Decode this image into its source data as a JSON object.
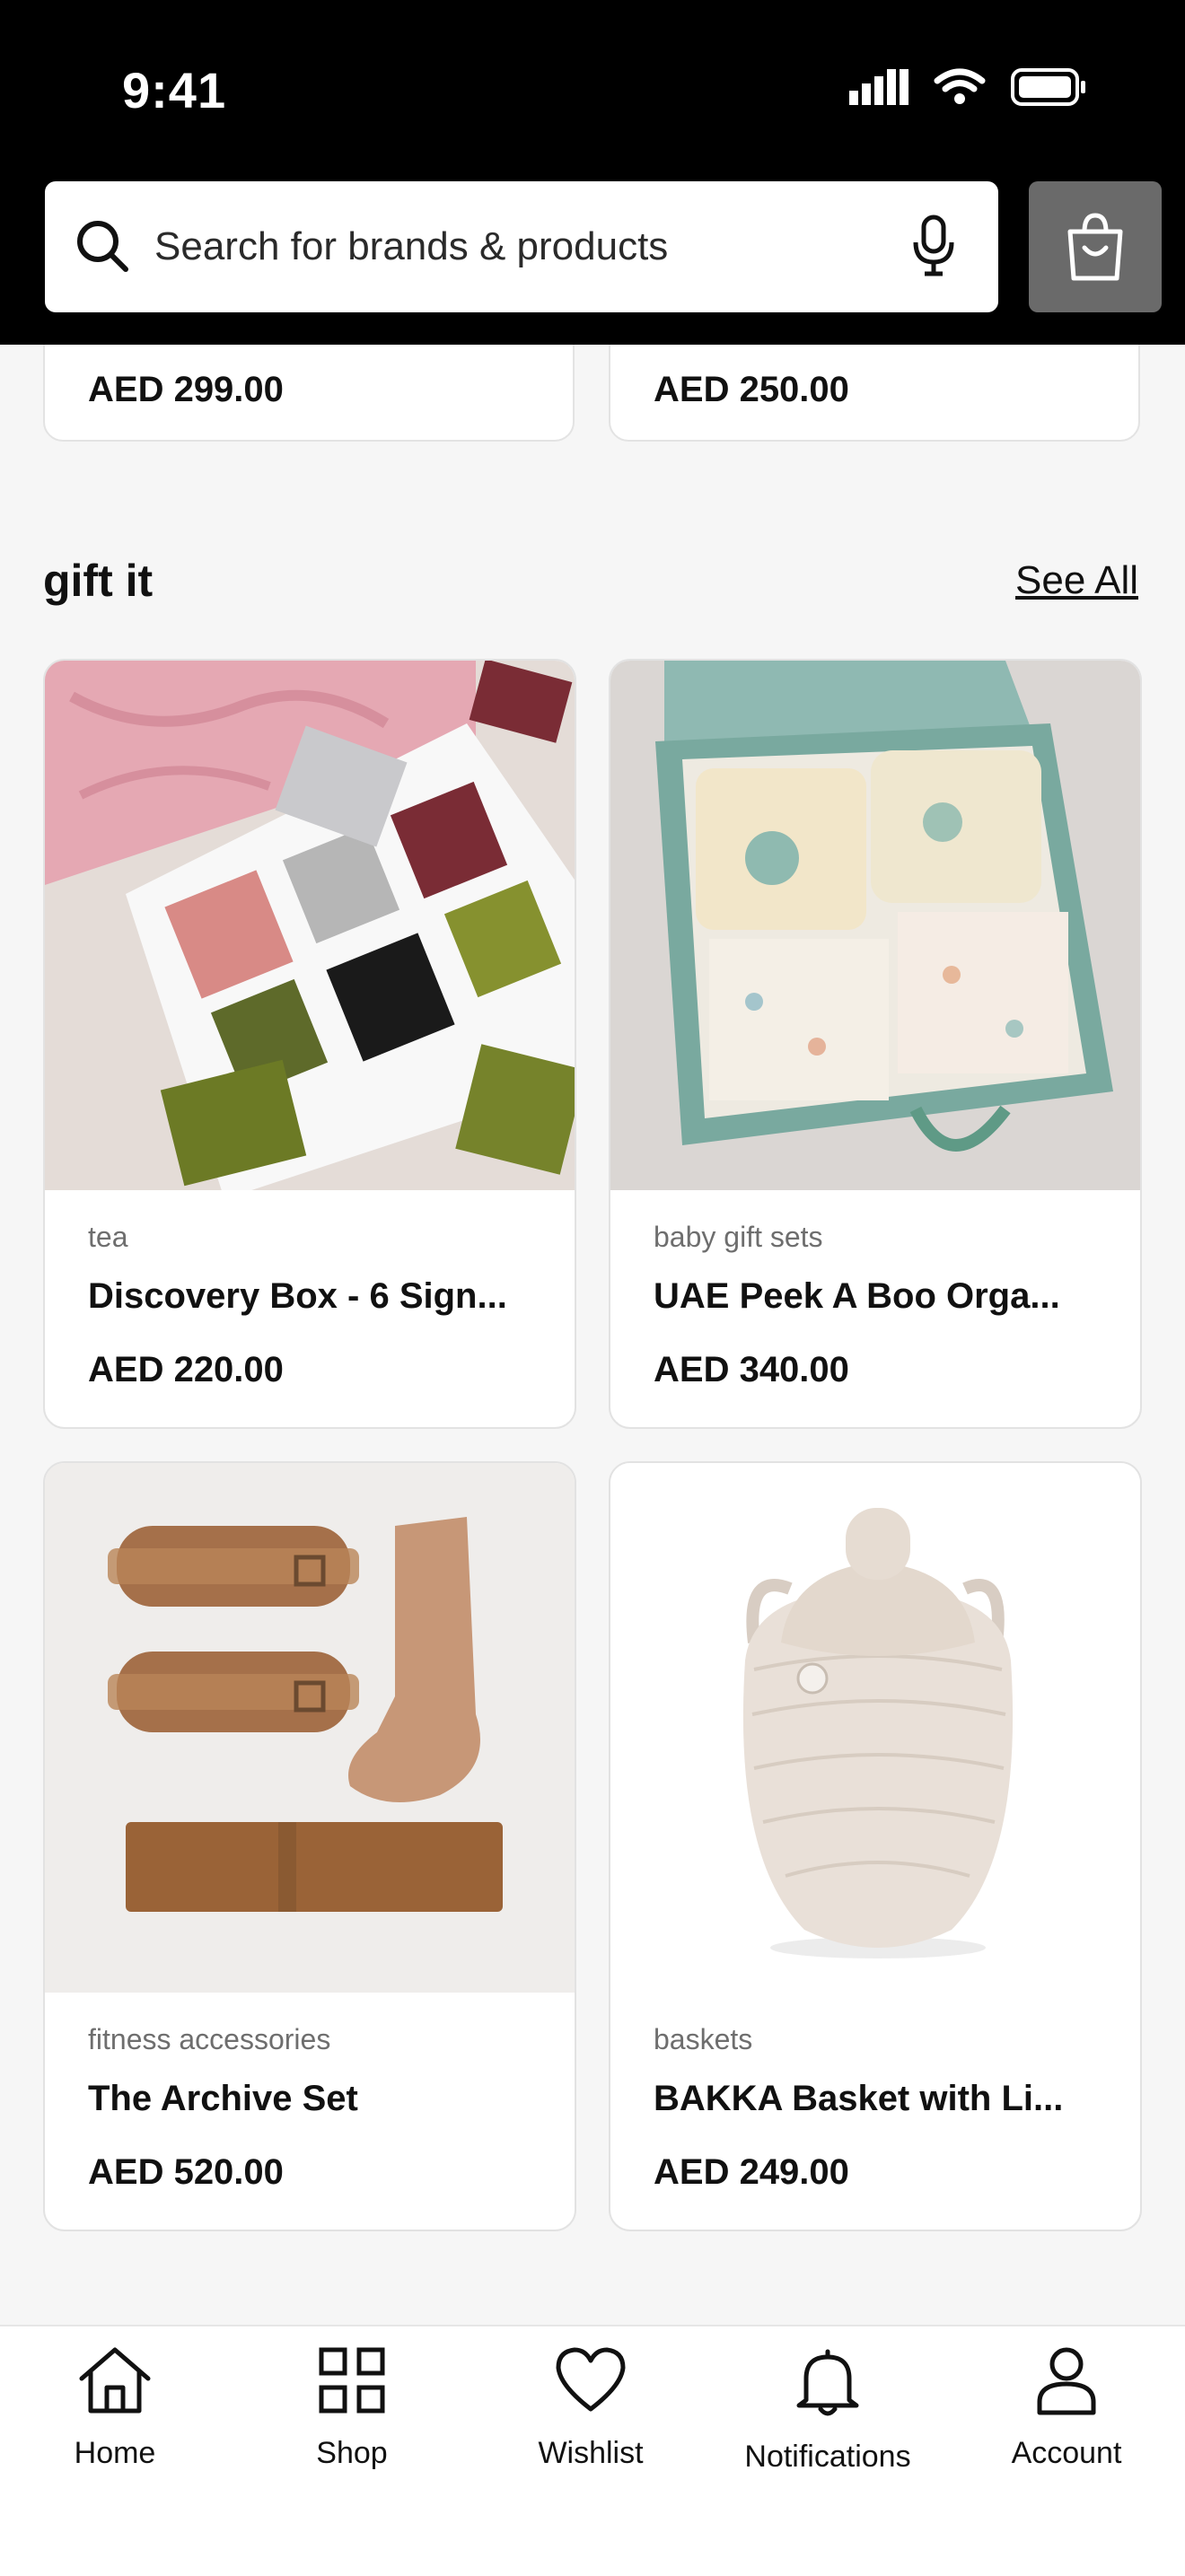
{
  "status_bar": {
    "time": "9:41"
  },
  "search": {
    "placeholder": "Search for brands & products"
  },
  "partial_cards": [
    {
      "price": "AED 299.00"
    },
    {
      "price": "AED 250.00"
    }
  ],
  "section": {
    "title": "gift it",
    "see_all": "See All"
  },
  "products": [
    {
      "category": "tea",
      "name": "Discovery Box - 6 Sign...",
      "price": "AED 220.00"
    },
    {
      "category": "baby gift sets",
      "name": "UAE Peek A Boo Orga...",
      "price": "AED 340.00"
    },
    {
      "category": "fitness accessories",
      "name": "The Archive Set",
      "price": "AED 520.00"
    },
    {
      "category": "baskets",
      "name": "BAKKA Basket with Li...",
      "price": "AED 249.00"
    }
  ],
  "nav": {
    "items": [
      {
        "label": "Home",
        "icon": "home-icon"
      },
      {
        "label": "Shop",
        "icon": "grid-icon"
      },
      {
        "label": "Wishlist",
        "icon": "heart-icon"
      },
      {
        "label": "Notifications",
        "icon": "bell-icon"
      },
      {
        "label": "Account",
        "icon": "user-icon"
      }
    ]
  },
  "colors": {
    "header_bg": "#000000",
    "cart_button": "#6a6a6a",
    "page_bg": "#f6f6f6"
  }
}
